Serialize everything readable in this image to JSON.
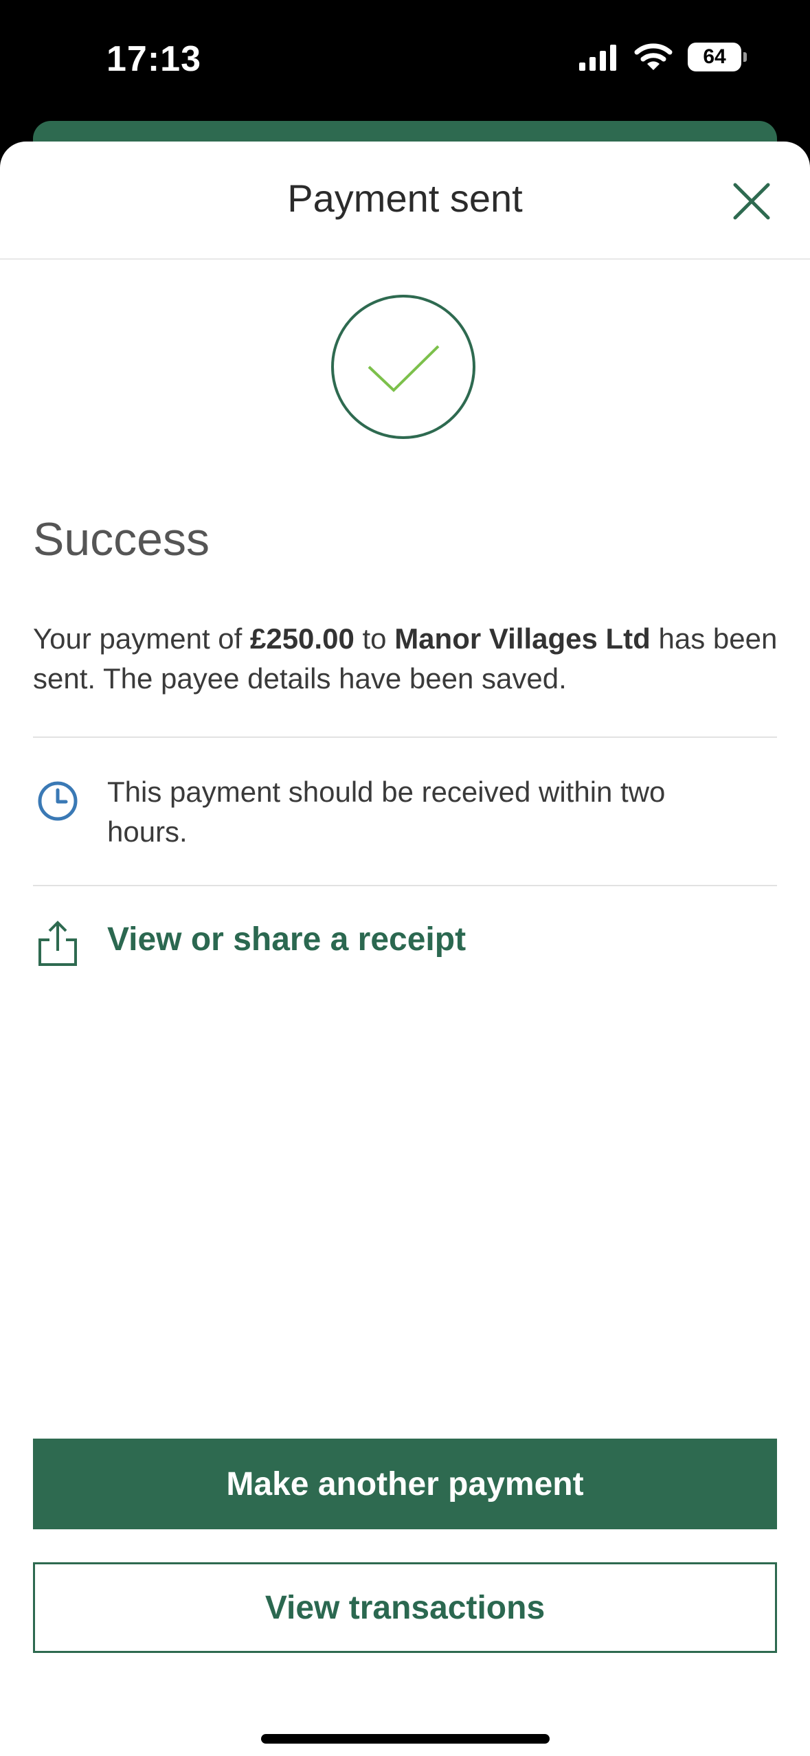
{
  "status_bar": {
    "time": "17:13",
    "battery": "64",
    "icons": [
      "signal-icon",
      "wifi-icon",
      "battery-icon"
    ]
  },
  "sheet": {
    "title": "Payment sent",
    "close_icon": "close-icon"
  },
  "result": {
    "icon": "checkmark-circle-icon",
    "heading": "Success",
    "message_prefix": "Your payment of ",
    "amount": "£250.00",
    "message_middle": " to ",
    "payee": "Manor Villages Ltd",
    "message_suffix": " has been sent. The payee details have been saved."
  },
  "info": {
    "icon": "clock-icon",
    "text": "This payment should be received within two hours."
  },
  "receipt": {
    "icon": "share-icon",
    "label": "View or share a receipt"
  },
  "actions": {
    "primary_label": "Make another payment",
    "secondary_label": "View transactions"
  },
  "colors": {
    "brand_green": "#2e6a50",
    "check_green": "#7cc04b",
    "clock_blue": "#3a79b5"
  }
}
